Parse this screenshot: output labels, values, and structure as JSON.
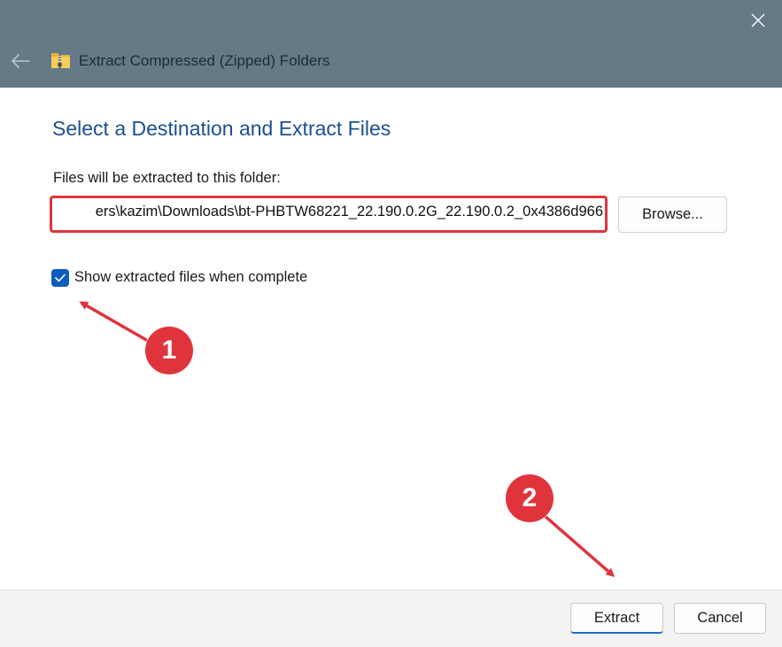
{
  "window": {
    "title": "Extract Compressed (Zipped) Folders"
  },
  "dialog": {
    "heading": "Select a Destination and Extract Files",
    "path_label": "Files will be extracted to this folder:",
    "path_value": "ers\\kazim\\Downloads\\bt-PHBTW68221_22.190.0.2G_22.190.0.2_0x4386d966",
    "browse_label": "Browse...",
    "checkbox_label": "Show extracted files when complete",
    "checkbox_checked": true
  },
  "footer": {
    "extract_label": "Extract",
    "cancel_label": "Cancel"
  },
  "annotations": {
    "badge_1": "1",
    "badge_2": "2",
    "color": "#e0343d"
  },
  "icons": {
    "close": "close-icon",
    "back": "back-arrow-icon",
    "folder": "zipped-folder-icon",
    "check": "checkmark-icon"
  }
}
